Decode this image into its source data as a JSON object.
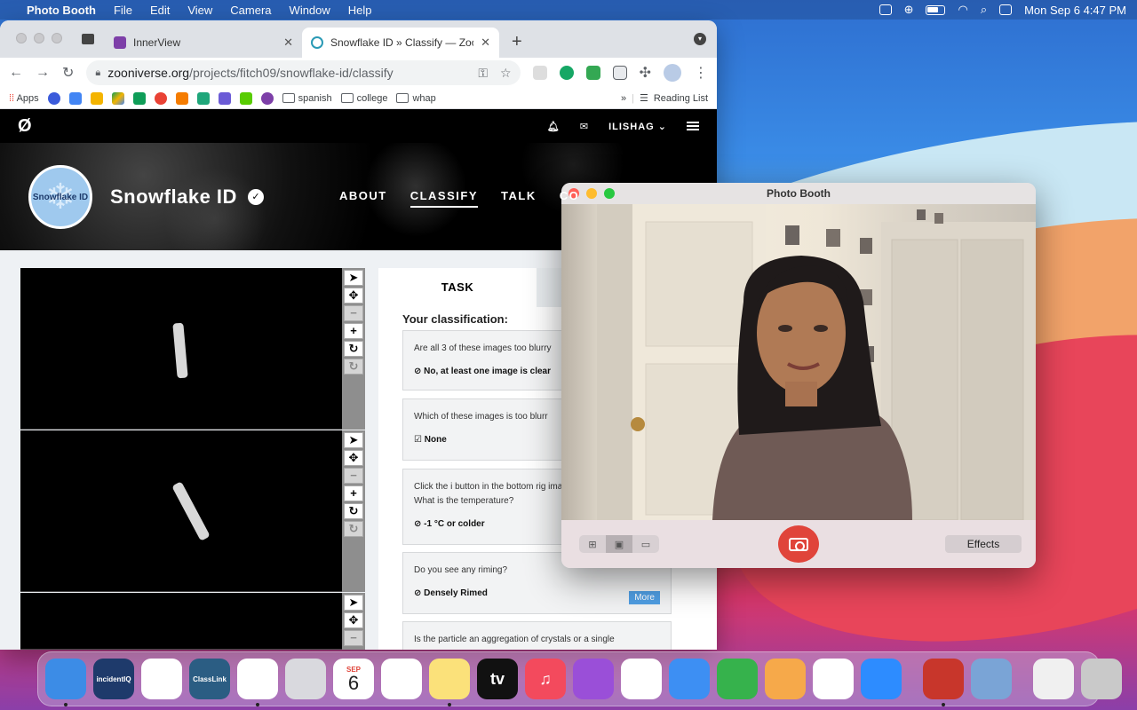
{
  "menubar": {
    "app": "Photo Booth",
    "items": [
      "File",
      "Edit",
      "View",
      "Camera",
      "Window",
      "Help"
    ],
    "clock": "Mon Sep 6  4:47 PM"
  },
  "browser": {
    "tabs": [
      {
        "title": "InnerView",
        "close": "✕"
      },
      {
        "title": "Snowflake ID » Classify — Zoo",
        "close": "✕"
      }
    ],
    "url_host": "zooniverse.org",
    "url_path": "/projects/fitch09/snowflake-id/classify",
    "bookmarks": {
      "apps": "Apps",
      "folders": [
        "spanish",
        "college",
        "whap"
      ],
      "reading_list": "Reading List"
    }
  },
  "zooniverse": {
    "user": "ILISHAG",
    "project_title": "Snowflake ID",
    "badge_text": "Snowflake ID",
    "nav": [
      "ABOUT",
      "CLASSIFY",
      "TALK",
      "CO"
    ],
    "task_tab": "TASK",
    "your_classification": "Your classification:",
    "questions": [
      {
        "q": "Are all 3 of these images too blurry",
        "a": "No, at least one image is clear"
      },
      {
        "q": "Which of these images is too blurr",
        "a": "None"
      },
      {
        "q": "Click the i button in the bottom rig image. What is the temperature?",
        "a": "-1 °C or colder"
      },
      {
        "q": "Do you see any riming?",
        "a": "Densely Rimed",
        "more": "More"
      },
      {
        "q": "Is the particle an aggregation of crystals or a single",
        "a": ""
      }
    ]
  },
  "photobooth": {
    "title": "Photo Booth",
    "effects_label": "Effects"
  },
  "dock": {
    "apps": [
      {
        "name": "Finder",
        "color": "#3c8ce6",
        "label": ""
      },
      {
        "name": "incidentIQ",
        "color": "#1e3a6b",
        "label": "incidentIQ"
      },
      {
        "name": "Google Drive",
        "color": "#ffffff",
        "label": ""
      },
      {
        "name": "ClassLink",
        "color": "#2b5d83",
        "label": "ClassLink"
      },
      {
        "name": "Chrome",
        "color": "#ffffff",
        "label": ""
      },
      {
        "name": "Launchpad",
        "color": "#d9d9de",
        "label": ""
      },
      {
        "name": "Calendar",
        "color": "#ffffff",
        "label": "6"
      },
      {
        "name": "Reminders",
        "color": "#ffffff",
        "label": ""
      },
      {
        "name": "Notes",
        "color": "#fbe17a",
        "label": ""
      },
      {
        "name": "Apple TV",
        "color": "#111111",
        "label": "tv"
      },
      {
        "name": "Music",
        "color": "#f34a5d",
        "label": "♫"
      },
      {
        "name": "Podcasts",
        "color": "#9a4fd8",
        "label": ""
      },
      {
        "name": "News",
        "color": "#ffffff",
        "label": ""
      },
      {
        "name": "Keynote",
        "color": "#3d8ff3",
        "label": ""
      },
      {
        "name": "Numbers",
        "color": "#36b24c",
        "label": ""
      },
      {
        "name": "Pages",
        "color": "#f6a94a",
        "label": ""
      },
      {
        "name": "Slack",
        "color": "#ffffff",
        "label": ""
      },
      {
        "name": "Zoom",
        "color": "#2d8cff",
        "label": ""
      },
      {
        "name": "Photo Booth",
        "color": "#c8362b",
        "label": ""
      },
      {
        "name": "Preview",
        "color": "#7aa4d6",
        "label": ""
      },
      {
        "name": "Document",
        "color": "#f0f0f0",
        "label": ""
      },
      {
        "name": "Trash",
        "color": "#c9c9c9",
        "label": ""
      }
    ],
    "calendar_month": "SEP"
  }
}
